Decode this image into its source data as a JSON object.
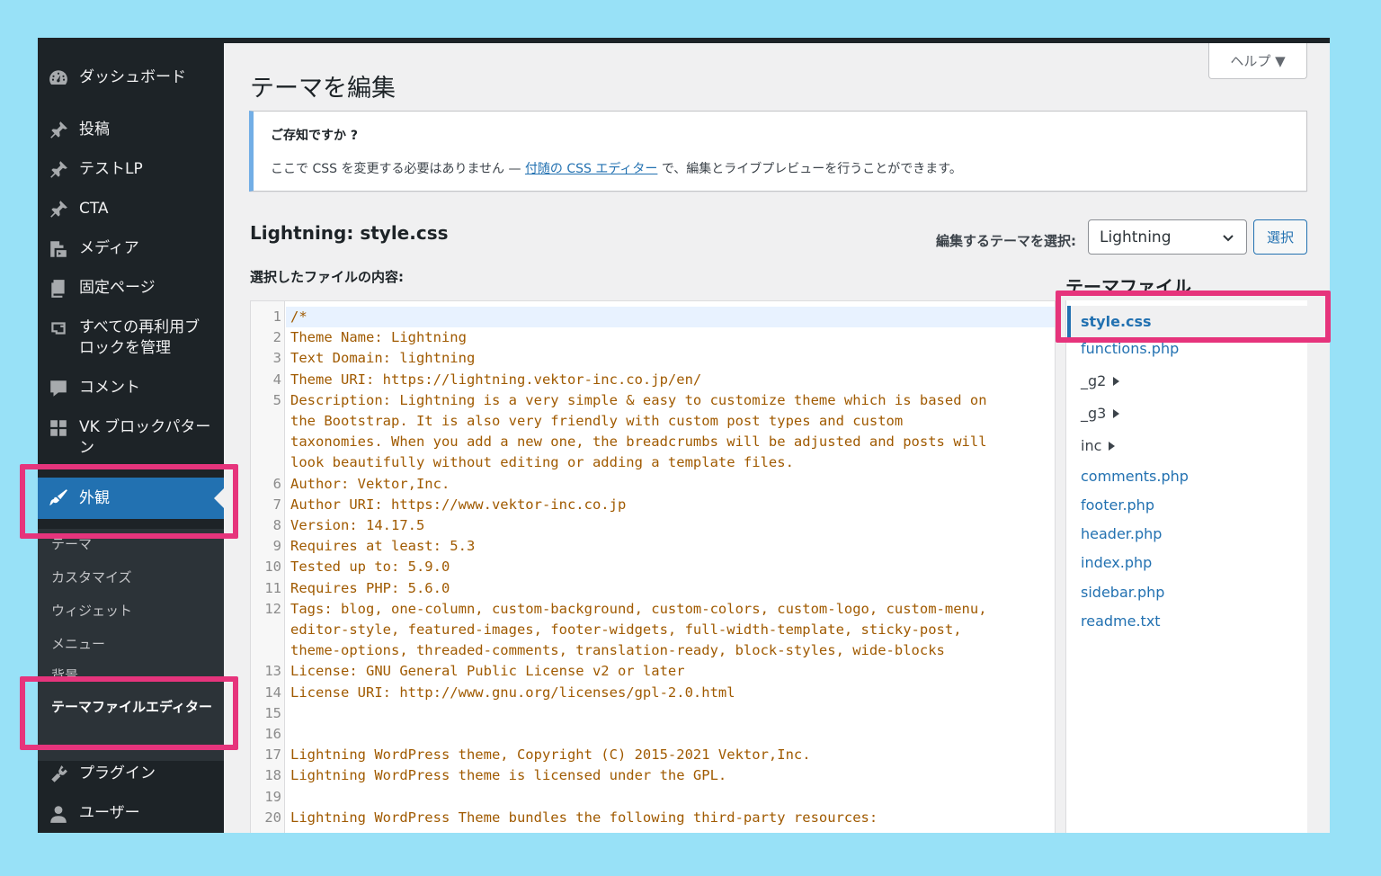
{
  "sidebar": {
    "items": [
      {
        "id": "dashboard",
        "label": "ダッシュボード",
        "icon": "dashboard-icon"
      },
      {
        "id": "posts",
        "label": "投稿",
        "icon": "pin-icon"
      },
      {
        "id": "testlp",
        "label": "テストLP",
        "icon": "pin-icon"
      },
      {
        "id": "cta",
        "label": "CTA",
        "icon": "pin-icon"
      },
      {
        "id": "media",
        "label": "メディア",
        "icon": "media-icon"
      },
      {
        "id": "pages",
        "label": "固定ページ",
        "icon": "page-icon"
      },
      {
        "id": "blocks",
        "label": "すべての再利用ブロックを管理",
        "icon": "block-icon"
      },
      {
        "id": "comments",
        "label": "コメント",
        "icon": "comment-icon"
      },
      {
        "id": "vkpattern",
        "label": "VK ブロックパターン",
        "icon": "grid-icon"
      },
      {
        "id": "appearance",
        "label": "外観",
        "icon": "paintbrush-icon"
      },
      {
        "id": "plugins",
        "label": "プラグイン",
        "icon": "plugin-icon"
      },
      {
        "id": "users",
        "label": "ユーザー",
        "icon": "user-icon"
      }
    ],
    "submenu": [
      {
        "id": "themes",
        "label": "テーマ"
      },
      {
        "id": "customize",
        "label": "カスタマイズ"
      },
      {
        "id": "widgets",
        "label": "ウィジェット"
      },
      {
        "id": "menus",
        "label": "メニュー"
      },
      {
        "id": "background",
        "label": "背景"
      },
      {
        "id": "theme-file-editor",
        "label": "テーマファイルエディター"
      }
    ]
  },
  "header": {
    "help_label": "ヘルプ ▼",
    "page_title": "テーマを編集"
  },
  "notice": {
    "title": "ご存知ですか ?",
    "text_before": "ここで CSS を変更する必要はありません — ",
    "link": "付随の CSS エディター",
    "text_after": " で、編集とライブプレビューを行うことができます。"
  },
  "editor": {
    "file_title": "Lightning: style.css",
    "theme_select_label": "編集するテーマを選択:",
    "theme_selected": "Lightning",
    "select_button": "選択",
    "content_label": "選択したファイルの内容:",
    "lines": [
      {
        "n": "1",
        "t": "/*"
      },
      {
        "n": "2",
        "t": "Theme Name: Lightning"
      },
      {
        "n": "3",
        "t": "Text Domain: lightning"
      },
      {
        "n": "4",
        "t": "Theme URI: https://lightning.vektor-inc.co.jp/en/"
      },
      {
        "n": "5",
        "t": "Description: Lightning is a very simple & easy to customize theme which is based on"
      },
      {
        "n": "",
        "t": "the Bootstrap. It is also very friendly with custom post types and custom"
      },
      {
        "n": "",
        "t": "taxonomies. When you add a new one, the breadcrumbs will be adjusted and posts will"
      },
      {
        "n": "",
        "t": "look beautifully without editing or adding a template files."
      },
      {
        "n": "6",
        "t": "Author: Vektor,Inc."
      },
      {
        "n": "7",
        "t": "Author URI: https://www.vektor-inc.co.jp"
      },
      {
        "n": "8",
        "t": "Version: 14.17.5"
      },
      {
        "n": "9",
        "t": "Requires at least: 5.3"
      },
      {
        "n": "10",
        "t": "Tested up to: 5.9.0"
      },
      {
        "n": "11",
        "t": "Requires PHP: 5.6.0"
      },
      {
        "n": "12",
        "t": "Tags: blog, one-column, custom-background, custom-colors, custom-logo, custom-menu,"
      },
      {
        "n": "",
        "t": "editor-style, featured-images, footer-widgets, full-width-template, sticky-post,"
      },
      {
        "n": "",
        "t": "theme-options, threaded-comments, translation-ready, block-styles, wide-blocks"
      },
      {
        "n": "13",
        "t": "License: GNU General Public License v2 or later"
      },
      {
        "n": "14",
        "t": "License URI: http://www.gnu.org/licenses/gpl-2.0.html"
      },
      {
        "n": "15",
        "t": ""
      },
      {
        "n": "16",
        "t": ""
      },
      {
        "n": "17",
        "t": "Lightning WordPress theme, Copyright (C) 2015-2021 Vektor,Inc."
      },
      {
        "n": "18",
        "t": "Lightning WordPress theme is licensed under the GPL."
      },
      {
        "n": "19",
        "t": ""
      },
      {
        "n": "20",
        "t": "Lightning WordPress Theme bundles the following third-party resources:"
      }
    ]
  },
  "files": {
    "heading": "テーマファイル",
    "items": [
      {
        "name": "style.css",
        "type": "file",
        "active": true
      },
      {
        "name": "functions.php",
        "type": "file"
      },
      {
        "name": "_g2",
        "type": "folder"
      },
      {
        "name": "_g3",
        "type": "folder"
      },
      {
        "name": "inc",
        "type": "folder"
      },
      {
        "name": "comments.php",
        "type": "file"
      },
      {
        "name": "footer.php",
        "type": "file"
      },
      {
        "name": "header.php",
        "type": "file"
      },
      {
        "name": "index.php",
        "type": "file"
      },
      {
        "name": "sidebar.php",
        "type": "file"
      },
      {
        "name": "readme.txt",
        "type": "file"
      }
    ]
  },
  "colors": {
    "sidebar_bg": "#1d2327",
    "accent": "#2271b1",
    "highlight": "#e6347c",
    "background": "#98e1f7"
  }
}
